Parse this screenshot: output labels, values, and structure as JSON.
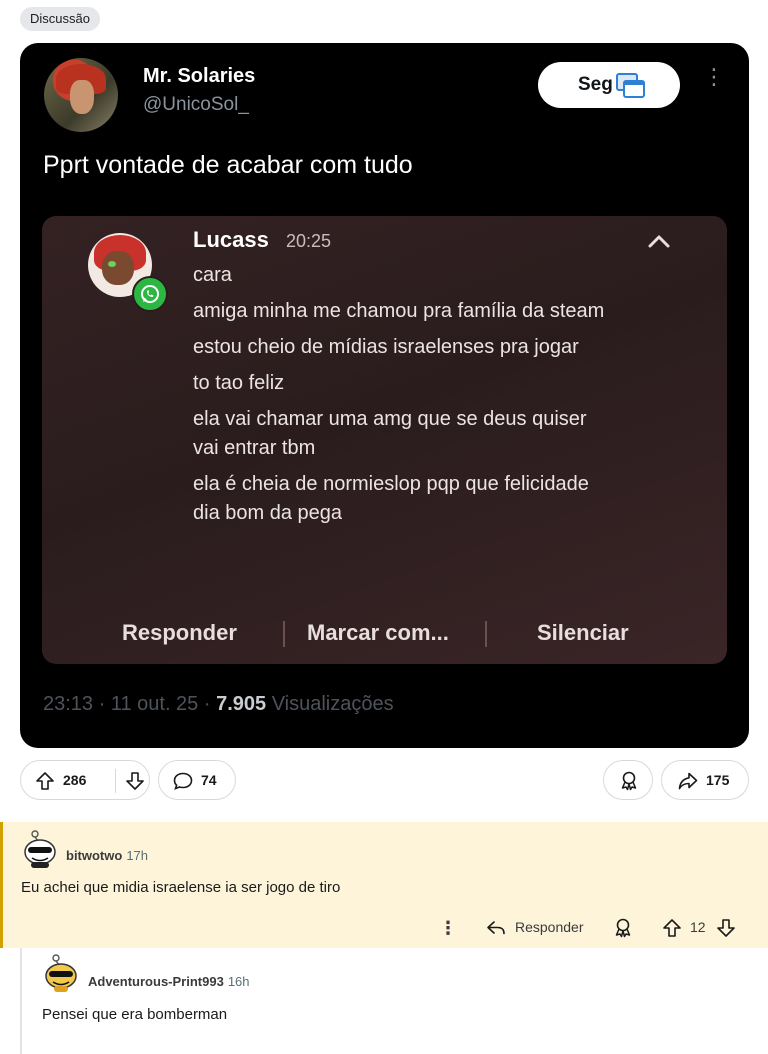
{
  "post": {
    "flair": "Discussão"
  },
  "tweet": {
    "name": "Mr. Solaries",
    "handle": "@UnicoSol_",
    "follow_label": "Seg",
    "text": "Pprt vontade de acabar com tudo",
    "meta_prefix": "23:13 · 11 out. 25 · ",
    "views_count": "7.905",
    "views_label": " Visualizações",
    "notification": {
      "sender": "Lucass",
      "time": "20:25",
      "messages": [
        "cara",
        "amiga minha me chamou pra família da steam",
        "estou cheio de mídias israelenses pra jogar",
        "to tao feliz",
        "ela vai chamar uma amg que se deus quiser vai entrar tbm",
        "ela é cheia de normieslop pqp que felicidade dia bom da pega"
      ],
      "actions": [
        "Responder",
        "Marcar com...",
        "Silenciar"
      ]
    }
  },
  "post_actions": {
    "upvotes": "286",
    "comments": "74",
    "shares": "175"
  },
  "comments": [
    {
      "user": "bitwotwo",
      "age": "17h",
      "body": "Eu achei que midia israelense ia ser jogo de tiro",
      "reply_label": "Responder",
      "votes": "12",
      "highlighted": true
    },
    {
      "user": "Adventurous-Print993",
      "age": "16h",
      "body": "Pensei que era bomberman"
    }
  ],
  "icons": [
    "arrow-up-icon",
    "arrow-down-icon",
    "comment-bubble-icon",
    "award-icon",
    "share-icon",
    "more-icon",
    "reply-icon",
    "chevron-up-icon",
    "whatsapp-icon",
    "window-icon"
  ]
}
